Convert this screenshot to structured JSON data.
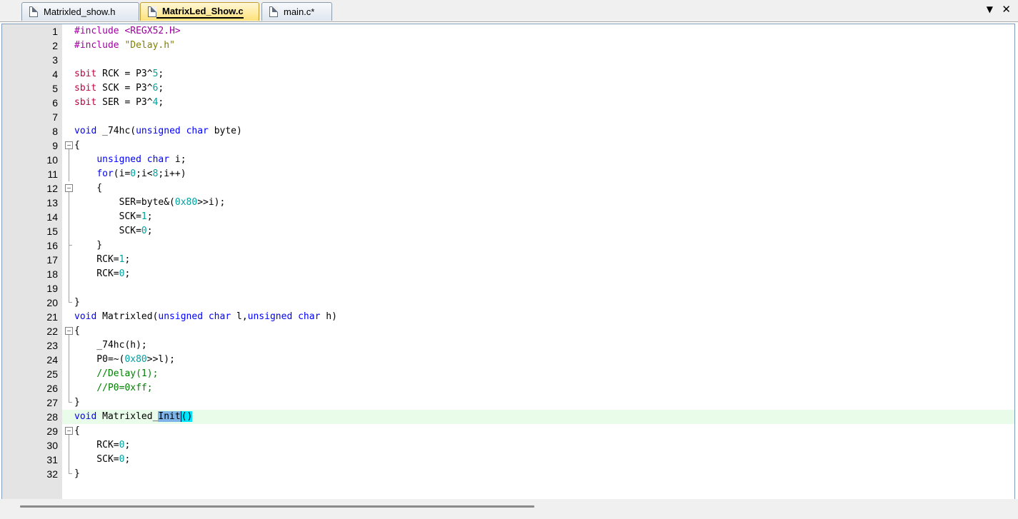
{
  "tabs": [
    {
      "label": "Matrixled_show.h",
      "active": false
    },
    {
      "label": "MatrixLed_Show.c",
      "active": true
    },
    {
      "label": "main.c*",
      "active": false
    }
  ],
  "tab_controls": {
    "dropdown_icon": "chevron-down-icon",
    "close_icon": "close-icon",
    "dropdown_glyph": "▼",
    "close_glyph": "✕"
  },
  "editor": {
    "current_line": 28,
    "selection": {
      "line": 28,
      "text": "Init"
    },
    "lines": [
      {
        "n": "1",
        "text": "#include <REGX52.H>"
      },
      {
        "n": "2",
        "text": "#include \"Delay.h\""
      },
      {
        "n": "3",
        "text": ""
      },
      {
        "n": "4",
        "text": "sbit RCK = P3^5;"
      },
      {
        "n": "5",
        "text": "sbit SCK = P3^6;"
      },
      {
        "n": "6",
        "text": "sbit SER = P3^4;"
      },
      {
        "n": "7",
        "text": ""
      },
      {
        "n": "8",
        "text": "void _74hc(unsigned char byte)"
      },
      {
        "n": "9",
        "text": "{"
      },
      {
        "n": "10",
        "text": "    unsigned char i;"
      },
      {
        "n": "11",
        "text": "    for(i=0;i<8;i++)"
      },
      {
        "n": "12",
        "text": "    {"
      },
      {
        "n": "13",
        "text": "        SER=byte&(0x80>>i);"
      },
      {
        "n": "14",
        "text": "        SCK=1;"
      },
      {
        "n": "15",
        "text": "        SCK=0;"
      },
      {
        "n": "16",
        "text": "    }"
      },
      {
        "n": "17",
        "text": "    RCK=1;"
      },
      {
        "n": "18",
        "text": "    RCK=0;"
      },
      {
        "n": "19",
        "text": ""
      },
      {
        "n": "20",
        "text": "}"
      },
      {
        "n": "21",
        "text": "void Matrixled(unsigned char l,unsigned char h)"
      },
      {
        "n": "22",
        "text": "{"
      },
      {
        "n": "23",
        "text": "    _74hc(h);"
      },
      {
        "n": "24",
        "text": "    P0=~(0x80>>l);"
      },
      {
        "n": "25",
        "text": "    //Delay(1);"
      },
      {
        "n": "26",
        "text": "    //P0=0xff;"
      },
      {
        "n": "27",
        "text": "}"
      },
      {
        "n": "28",
        "text": "void Matrixled_Init()"
      },
      {
        "n": "29",
        "text": "{"
      },
      {
        "n": "30",
        "text": "    RCK=0;"
      },
      {
        "n": "31",
        "text": "    SCK=0;"
      },
      {
        "n": "32",
        "text": "}"
      }
    ]
  },
  "colors": {
    "keyword": "#0000ff",
    "preprocessor": "#a000a0",
    "string": "#808000",
    "number": "#00a0a0",
    "comment": "#008000",
    "sbit": "#c00040",
    "current_line_bg": "#e9fbe9",
    "selection_bg": "#7fb4e8",
    "brace_match_bg": "#00e5ff",
    "active_tab": "#ffe27a"
  }
}
